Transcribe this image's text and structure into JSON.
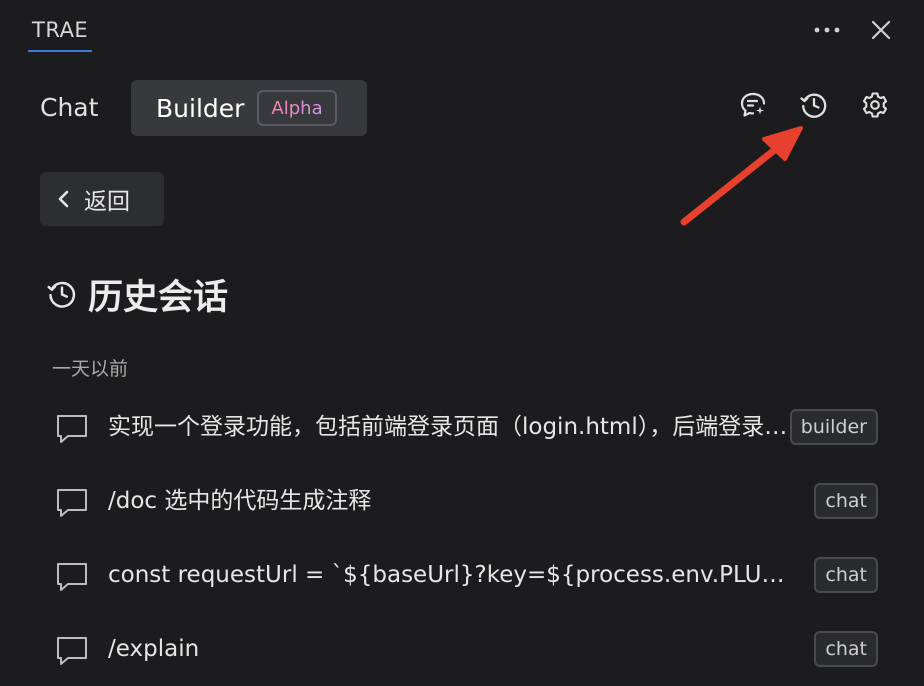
{
  "panel": {
    "title": "TRAE"
  },
  "modes": {
    "chat_label": "Chat",
    "builder_label": "Builder",
    "builder_badge": "Alpha"
  },
  "back": {
    "label": "返回"
  },
  "history": {
    "title": "历史会话",
    "group_label": "一天以前",
    "items": [
      {
        "title": "实现一个登录功能，包括前端登录页面（login.html），后端登录接口",
        "type": "builder"
      },
      {
        "title": "/doc 选中的代码生成注释",
        "type": "chat"
      },
      {
        "title": "const requestUrl = `${baseUrl}?key=${process.env.PLUGIN_KEY}`",
        "type": "chat"
      },
      {
        "title": "/explain",
        "type": "chat"
      }
    ]
  },
  "icons": {
    "more": "more-horizontal-icon",
    "close": "close-icon",
    "new_chat": "new-chat-icon",
    "history": "history-icon",
    "settings": "gear-icon",
    "back": "chevron-left-icon",
    "history_item": "chat-bubble-icon"
  },
  "colors": {
    "background": "#1c1c1e",
    "active_tab_underline": "#3a7bd5",
    "builder_tab_bg": "#38393d",
    "annotation_arrow": "#e8402f"
  }
}
